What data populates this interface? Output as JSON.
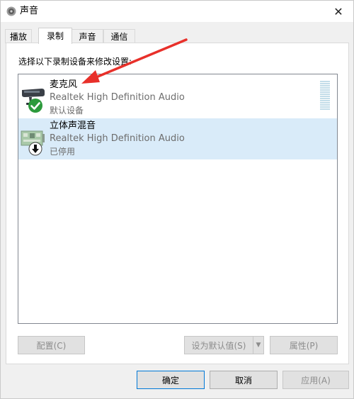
{
  "window": {
    "title": "声音",
    "close_label": "✕"
  },
  "tabs": [
    {
      "label": "播放",
      "active": false
    },
    {
      "label": "录制",
      "active": true
    },
    {
      "label": "声音",
      "active": false
    },
    {
      "label": "通信",
      "active": false
    }
  ],
  "panel": {
    "instruction": "选择以下录制设备来修改设置:"
  },
  "devices": [
    {
      "name": "麦克风",
      "driver": "Realtek High Definition Audio",
      "state": "默认设备",
      "status_icon": "check-circle-icon",
      "device_icon": "microphone-icon",
      "level_bars": 14
    },
    {
      "name": "立体声混音",
      "driver": "Realtek High Definition Audio",
      "state": "已停用",
      "status_icon": "disabled-down-arrow-icon",
      "device_icon": "sound-card-icon"
    }
  ],
  "panel_buttons": {
    "configure": "配置(C)",
    "set_default": "设为默认值(S)",
    "properties": "属性(P)"
  },
  "dialog_buttons": {
    "ok": "确定",
    "cancel": "取消",
    "apply": "应用(A)"
  },
  "colors": {
    "selected_row": "#d9ebf9",
    "annotation_arrow": "#e8302a",
    "check_green": "#2c9a3c",
    "primary_border": "#0078d7"
  }
}
